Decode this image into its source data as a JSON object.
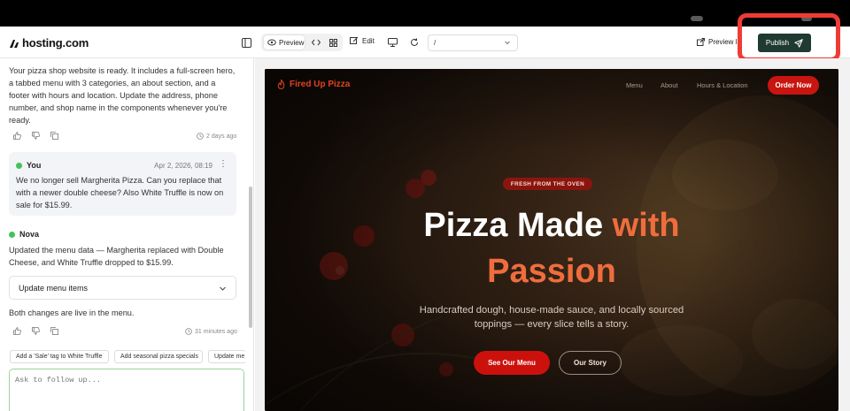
{
  "app": {
    "brand": "hosting.com"
  },
  "toolbar": {
    "preview_label": "Preview",
    "edit_label": "Edit",
    "url_value": "/",
    "preview_link_label": "Preview l",
    "publish_label": "Publish"
  },
  "chat": {
    "intro_message": "Your pizza shop website is ready. It includes a full-screen hero, a tabbed menu with 3 categories, an about section, and a footer with hours and location. Update the address, phone number, and shop name in the components whenever you're ready.",
    "intro_time": "2 days ago",
    "user": {
      "name": "You",
      "date": "Apr 2, 2026, 08:19",
      "message": "We no longer sell Margherita Pizza. Can you replace that with a newer double cheese? Also White Truffle is now on sale for $15.99."
    },
    "assistant": {
      "name": "Nova",
      "message": "Updated the menu data — Margherita replaced with Double Cheese, and White Truffle dropped to $15.99.",
      "collapsible_label": "Update menu items",
      "followup_message": "Both changes are live in the menu.",
      "time": "31 minutes ago"
    },
    "suggestions": [
      "Add a 'Sale' tag to White Truffle",
      "Add seasonal pizza specials",
      "Update me"
    ],
    "input_placeholder": "Ask to follow up..."
  },
  "site": {
    "brand": "Fired Up Pizza",
    "nav": [
      "Menu",
      "About",
      "Hours & Location"
    ],
    "order_button": "Order Now",
    "badge": "FRESH FROM THE OVEN",
    "headline_white": "Pizza Made ",
    "headline_accent": "with",
    "headline_line2": "Passion",
    "subtitle": "Handcrafted dough, house-made sauce, and locally sourced toppings — every slice tells a story.",
    "cta_primary": "See Our Menu",
    "cta_secondary": "Our Story"
  },
  "colors": {
    "publish_bg": "#1f3a31",
    "highlight_border": "#ef3b36",
    "site_accent": "#ef6d3d",
    "site_red": "#cc110d"
  }
}
